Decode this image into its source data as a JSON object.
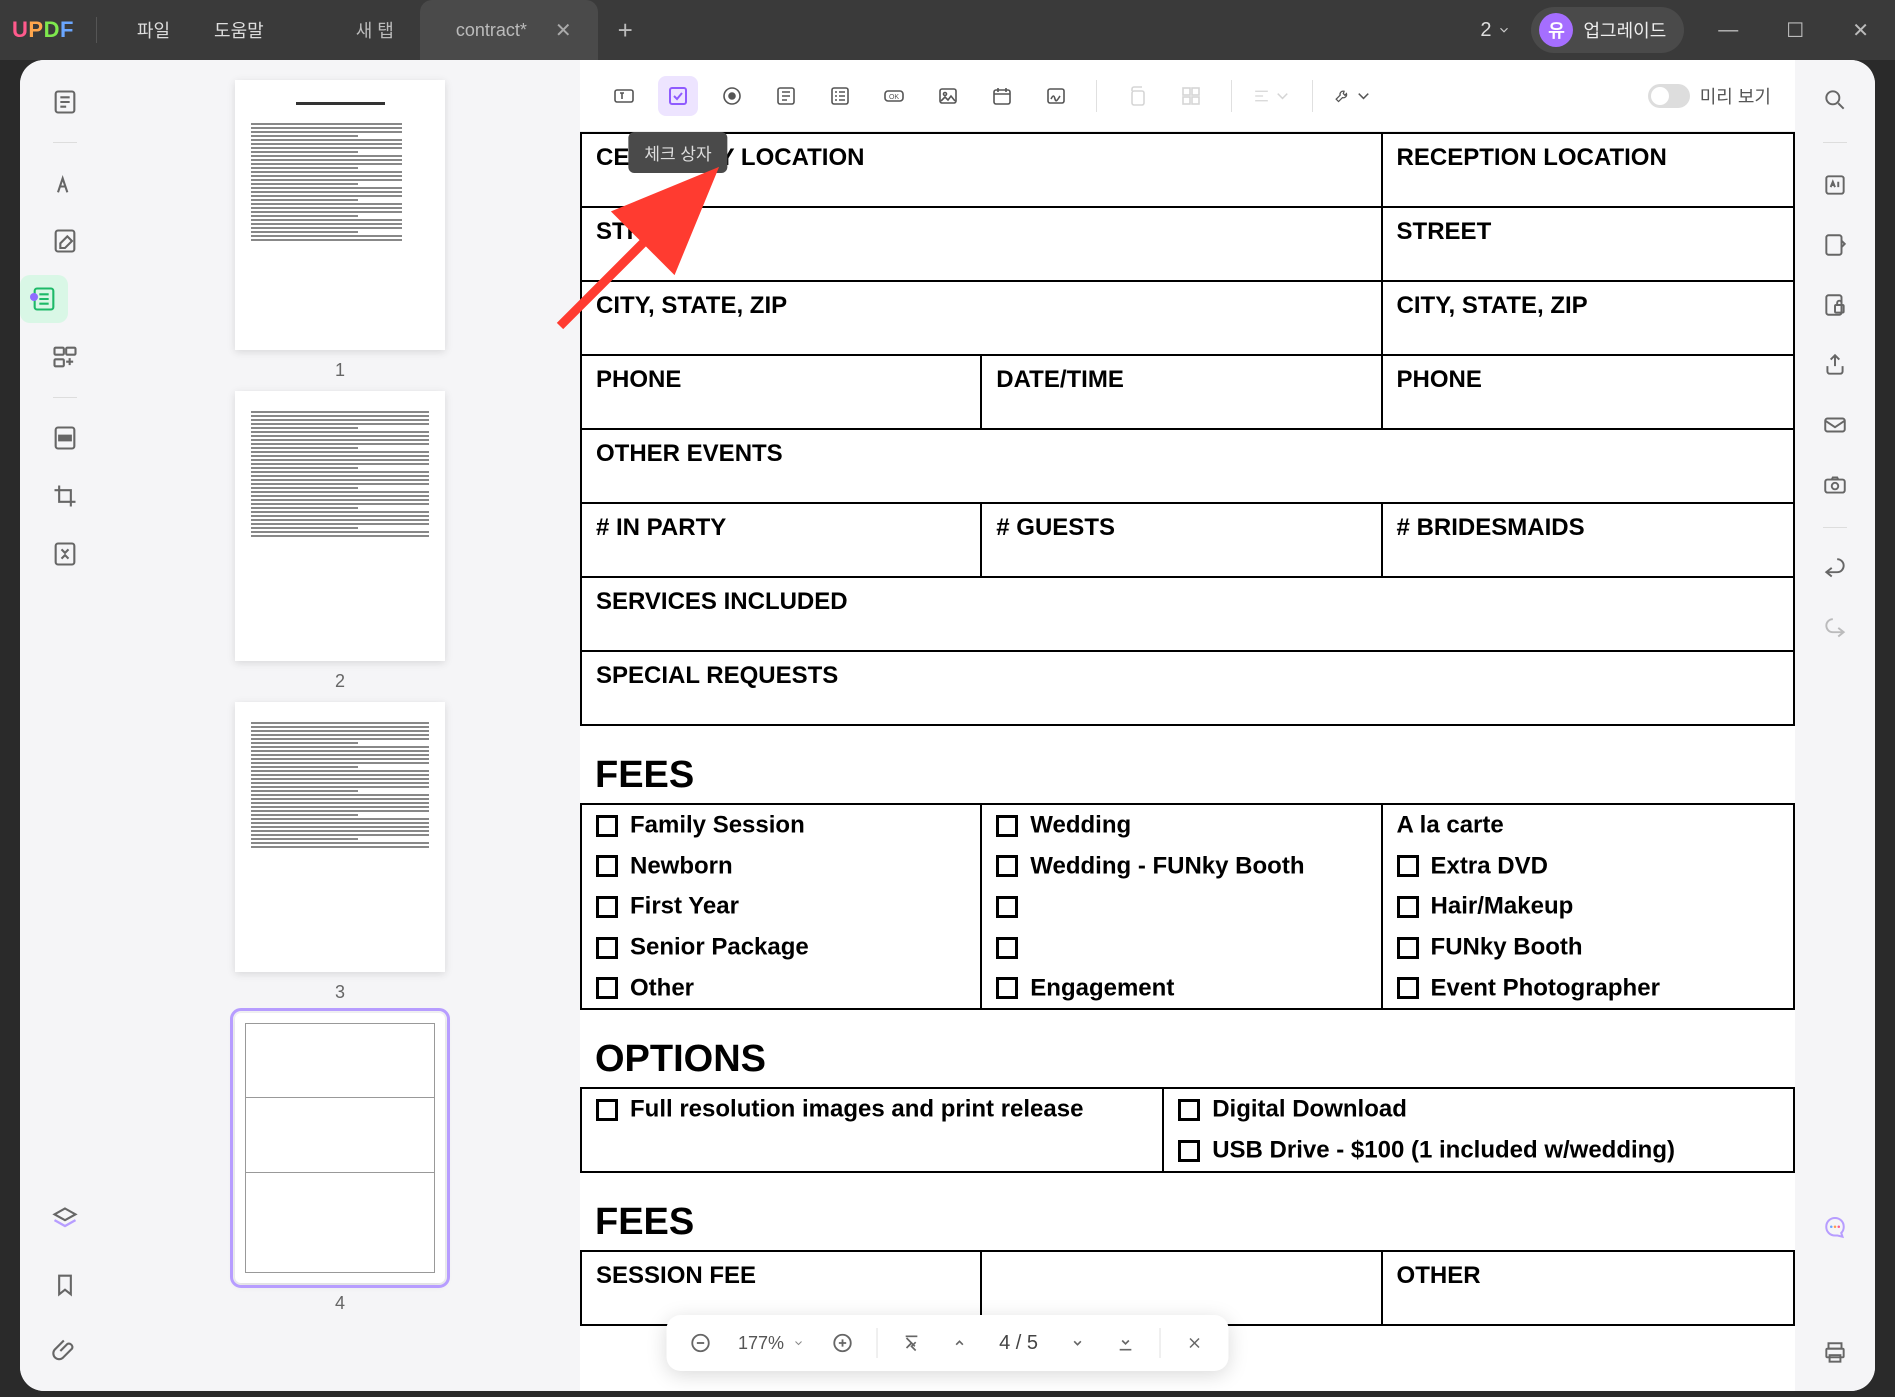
{
  "titlebar": {
    "menus": [
      "파일",
      "도움말"
    ],
    "tabs": [
      {
        "label": "새 탭",
        "active": false
      },
      {
        "label": "contract*",
        "active": true
      }
    ],
    "tab_count": "2",
    "upgrade_label": "업그레이드",
    "upgrade_badge": "유"
  },
  "toolbar": {
    "tooltip_checkbox": "체크 상자",
    "preview_label": "미리 보기"
  },
  "thumbnails": {
    "pages": [
      "1",
      "2",
      "3",
      "4"
    ],
    "selected": 4
  },
  "document": {
    "row1": {
      "ceremony": "CEREMONY LOCATION",
      "reception": "RECEPTION LOCATION"
    },
    "row2": {
      "street_l": "STREET",
      "street_r": "STREET"
    },
    "row3": {
      "csz_l": "CITY, STATE, ZIP",
      "csz_r": "CITY, STATE, ZIP"
    },
    "row4": {
      "phone_l": "PHONE",
      "datetime": "DATE/TIME",
      "phone_r": "PHONE"
    },
    "row5": {
      "other_events": "OTHER EVENTS"
    },
    "row6": {
      "in_party": "# IN PARTY",
      "guests": "# GUESTS",
      "bridesmaids": "# BRIDESMAIDS"
    },
    "row7": {
      "services": "SERVICES INCLUDED"
    },
    "row8": {
      "special": "SPECIAL REQUESTS"
    },
    "fees_head": "FEES",
    "fees": {
      "col1": [
        "Family Session",
        "Newborn",
        "First Year",
        "Senior Package",
        "Other"
      ],
      "col2": [
        "Wedding",
        "Wedding - FUNky Booth",
        "",
        "",
        "Engagement"
      ],
      "col3_head": "A la carte",
      "col3": [
        "Extra DVD",
        "Hair/Makeup",
        "FUNky Booth",
        "Event Photographer"
      ]
    },
    "options_head": "OPTIONS",
    "options": {
      "left": "Full resolution images and print release",
      "right1": "Digital Download",
      "right2": "USB Drive - $100 (1 included w/wedding)"
    },
    "fees2_head": "FEES",
    "fees2_row": {
      "session": "SESSION FEE",
      "other": "OTHER"
    }
  },
  "pagenav": {
    "zoom": "177%",
    "page": "4 / 5"
  }
}
